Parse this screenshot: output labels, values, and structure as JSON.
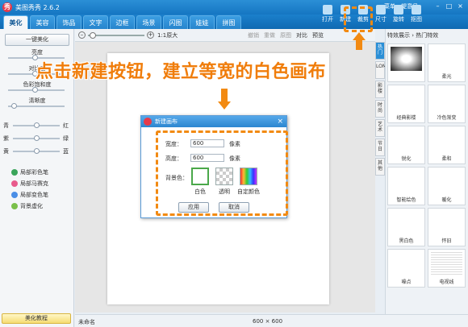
{
  "app": {
    "title": "美图秀秀 2.6.2"
  },
  "titlebar": {
    "links": [
      "菜单",
      "提意见"
    ],
    "window_buttons": [
      "–",
      "□",
      "×"
    ]
  },
  "tabs": [
    {
      "label": "美化",
      "active": true
    },
    {
      "label": "美容"
    },
    {
      "label": "饰品"
    },
    {
      "label": "文字"
    },
    {
      "label": "边框"
    },
    {
      "label": "场景"
    },
    {
      "label": "闪图"
    },
    {
      "label": "娃娃"
    },
    {
      "label": "拼图"
    }
  ],
  "top_tools": [
    "打开",
    "新建",
    "裁剪",
    "尺寸",
    "旋转",
    "抠图"
  ],
  "left_panel": {
    "beauty_button": "一键美化",
    "sliders": [
      "亮度",
      "对比度",
      "色彩饱和度",
      "清晰度"
    ],
    "color_balance": [
      {
        "left": "青",
        "right": "红"
      },
      {
        "left": "紫",
        "right": "绿"
      },
      {
        "left": "黄",
        "right": "蓝"
      }
    ],
    "brushes": [
      {
        "label": "局部彩色笔",
        "color": "#3aa55a"
      },
      {
        "label": "局部马赛克",
        "color": "#e85a8c"
      },
      {
        "label": "局部变色笔",
        "color": "#4a8ee6"
      },
      {
        "label": "背景虚化",
        "color": "#7ac04a"
      }
    ],
    "tutorial_button": "美化教程"
  },
  "toolbar": {
    "zoom_text": "1:1原大",
    "buttons": [
      "撤销",
      "重做",
      "原图",
      "对比",
      "预览"
    ]
  },
  "side_tabs": [
    "热门",
    "LOMO",
    "影楼",
    "时尚",
    "艺术",
    "节日",
    "其他"
  ],
  "right_panel": {
    "header": "特效展示 › 热门特效",
    "effects": [
      "",
      "柔光",
      "经典影楼",
      "冷色渐变",
      "锐化",
      "柔和",
      "智能绘色",
      "暖化",
      "黑白色",
      "怀旧",
      "噪点",
      "电视线"
    ]
  },
  "dialog": {
    "title": "新建画布",
    "width_label": "宽度：",
    "width_value": "600",
    "height_label": "高度：",
    "height_value": "600",
    "unit": "像素",
    "bg_label": "背景色：",
    "bg_options": [
      "白色",
      "透明",
      "自定颜色"
    ],
    "ok_button": "应用",
    "cancel_button": "取消"
  },
  "annotation": {
    "headline": "点击新建按钮，建立等宽的白色画布"
  },
  "status": {
    "name": "未命名",
    "size": "600 × 600"
  },
  "colors": {
    "accent": "#1b80cc",
    "highlight": "#f28a12"
  }
}
